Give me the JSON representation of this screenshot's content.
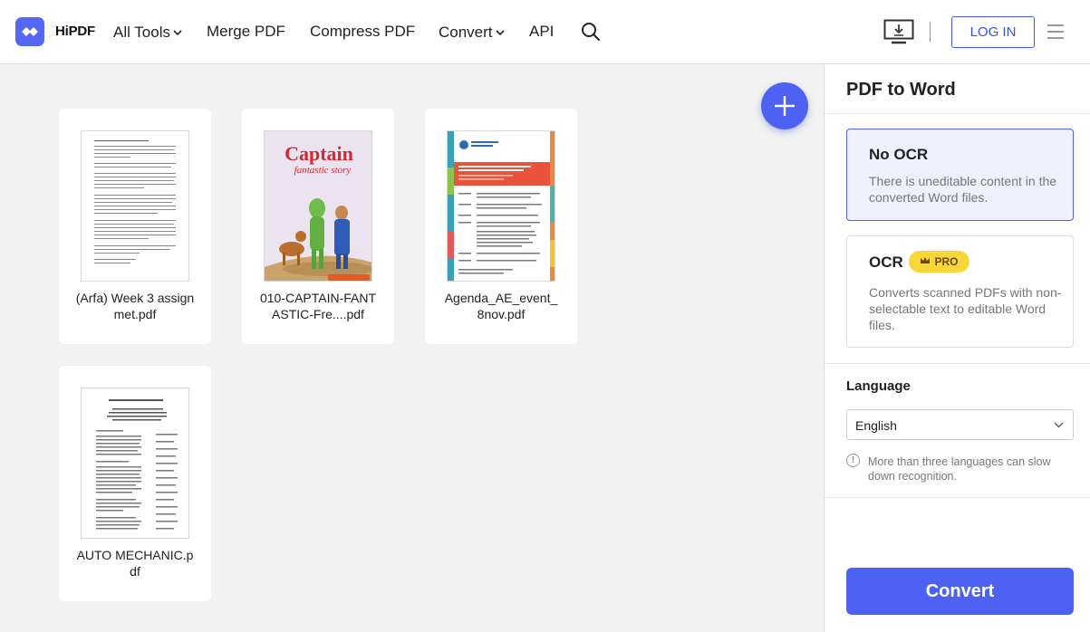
{
  "header": {
    "brand": "HiPDF",
    "nav": [
      {
        "label": "All Tools",
        "has_dropdown": true
      },
      {
        "label": "Merge PDF",
        "has_dropdown": false
      },
      {
        "label": "Compress PDF",
        "has_dropdown": false
      },
      {
        "label": "Convert",
        "has_dropdown": true
      },
      {
        "label": "API",
        "has_dropdown": false
      }
    ],
    "login_label": "LOG IN",
    "icons": [
      "search-icon",
      "desktop-download-icon",
      "hamburger-menu-icon"
    ]
  },
  "files": [
    {
      "name": "(Arfa) Week 3 assignmet.pdf",
      "thumbnail": "text-document"
    },
    {
      "name": "010-CAPTAIN-FANTASTIC-Fre....pdf",
      "thumbnail": "comic-cover",
      "cover_title": "Captain",
      "cover_subtitle": "fantastic story"
    },
    {
      "name": "Agenda_AE_event_8nov.pdf",
      "thumbnail": "agenda-document"
    },
    {
      "name": "AUTO MECHANIC.pdf",
      "thumbnail": "occupation-document"
    }
  ],
  "panel": {
    "title": "PDF to Word",
    "options": [
      {
        "title": "No OCR",
        "description": "There is uneditable content in the converted Word files.",
        "selected": true
      },
      {
        "title": "OCR",
        "badge": "PRO",
        "description": "Converts scanned PDFs with non-selectable text to editable Word files.",
        "selected": false
      }
    ],
    "language_label": "Language",
    "language_value": "English",
    "language_note": "More than three languages can slow down recognition.",
    "convert_label": "Convert"
  },
  "colors": {
    "accent": "#4d61f2",
    "pro_badge": "#f9d637",
    "workspace_bg": "#f2f2f2"
  }
}
